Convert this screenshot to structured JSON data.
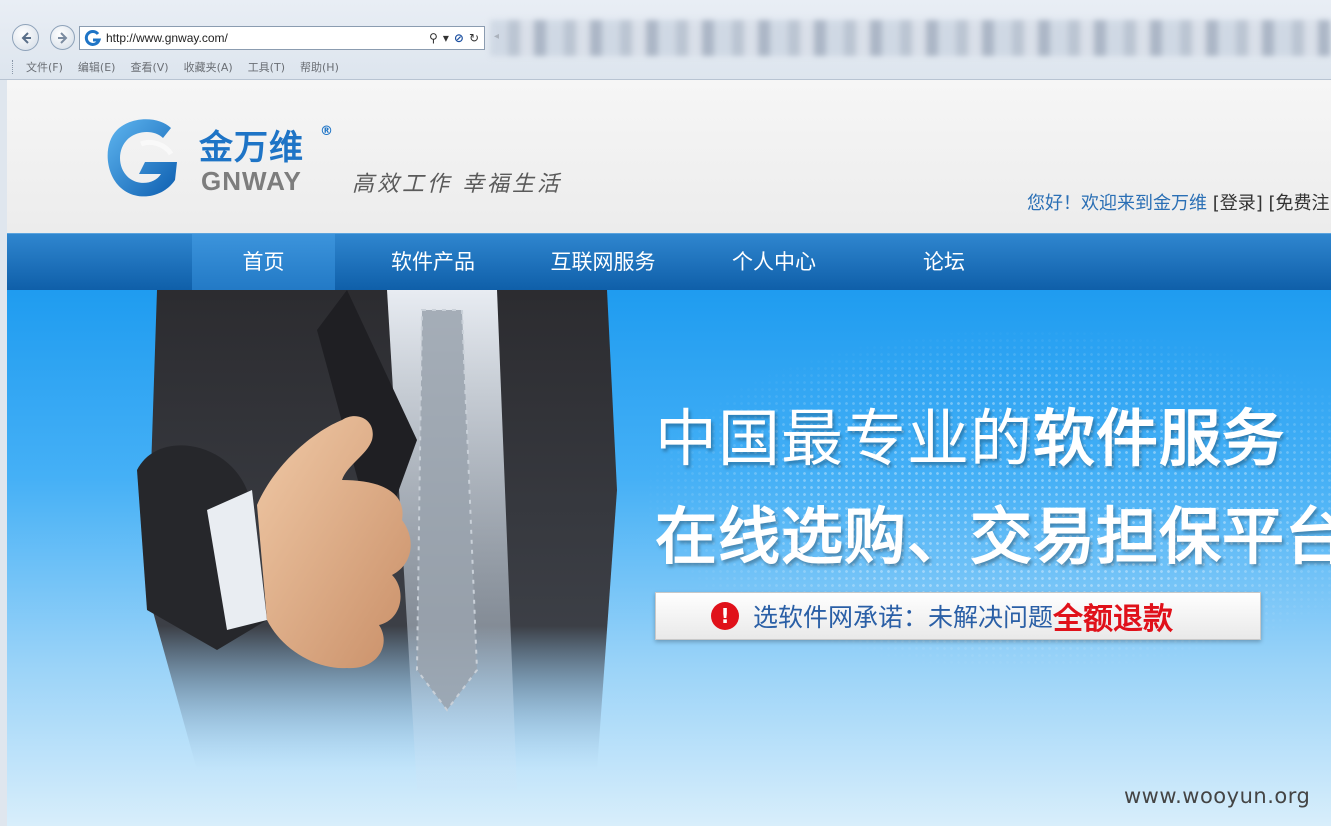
{
  "browser": {
    "url": "http://www.gnway.com/",
    "menu": [
      "文件(F)",
      "编辑(E)",
      "查看(V)",
      "收藏夹(A)",
      "工具(T)",
      "帮助(H)"
    ],
    "icons": {
      "back": "back-arrow-icon",
      "forward": "forward-arrow-icon",
      "search": "search-icon",
      "dropdown": "dropdown-icon",
      "stop": "stop-icon",
      "refresh": "refresh-icon"
    }
  },
  "header": {
    "brand_cn": "金万维",
    "brand_mark": "®",
    "brand_en": "GNWAY",
    "slogan": "高效工作 幸福生活",
    "welcome_text": "您好！欢迎来到金万维",
    "login_link": "[登录]",
    "register_link": "[免费注"
  },
  "nav": {
    "items": [
      "首页",
      "软件产品",
      "互联网服务",
      "个人中心",
      "论坛"
    ],
    "active_index": 0
  },
  "banner": {
    "headline1_normal": "中国最专业的",
    "headline1_bold": "软件服务",
    "headline2": "在线选购、交易担保平台",
    "alert_glyph": "!",
    "promise_text": "选软件网承诺：未解决问题",
    "promise_strong": "全额退款"
  },
  "watermark": "www.wooyun.org",
  "colors": {
    "brand_blue": "#1e74c6",
    "nav_blue": "#1565b0",
    "banner_blue": "#1f9cf0",
    "alert_red": "#e0111a"
  }
}
